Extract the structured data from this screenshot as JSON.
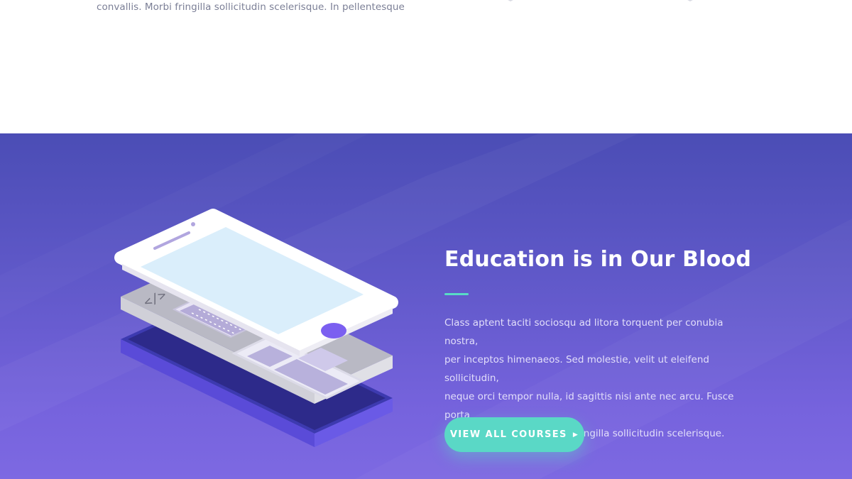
{
  "top_section": {
    "text": "convallis. Morbi fringilla sollicitudin scelerisque. In pellentesque"
  },
  "hero": {
    "title": "Education is in Our Blood",
    "body": "Class aptent taciti sociosqu ad litora torquent per conubia nostra,\nper inceptos himenaeos. Sed molestie, velit ut eleifend sollicitudin,\nneque orci tempor nulla, id sagittis nisi ante nec arcu. Fusce porta\nbibendum convallis. Morbi fringilla sollicitudin scelerisque.",
    "cta_label": "VIEW ALL COURSES",
    "cta_icon": "caret-right-icon",
    "code_glyph": "</>"
  },
  "colors": {
    "hero_gradient_top": "#4b4db5",
    "hero_gradient_bottom": "#7d69e2",
    "accent_teal": "#5ad8c6",
    "phone_screen": "#dbeefb",
    "phone_button": "#7b5ff0"
  }
}
